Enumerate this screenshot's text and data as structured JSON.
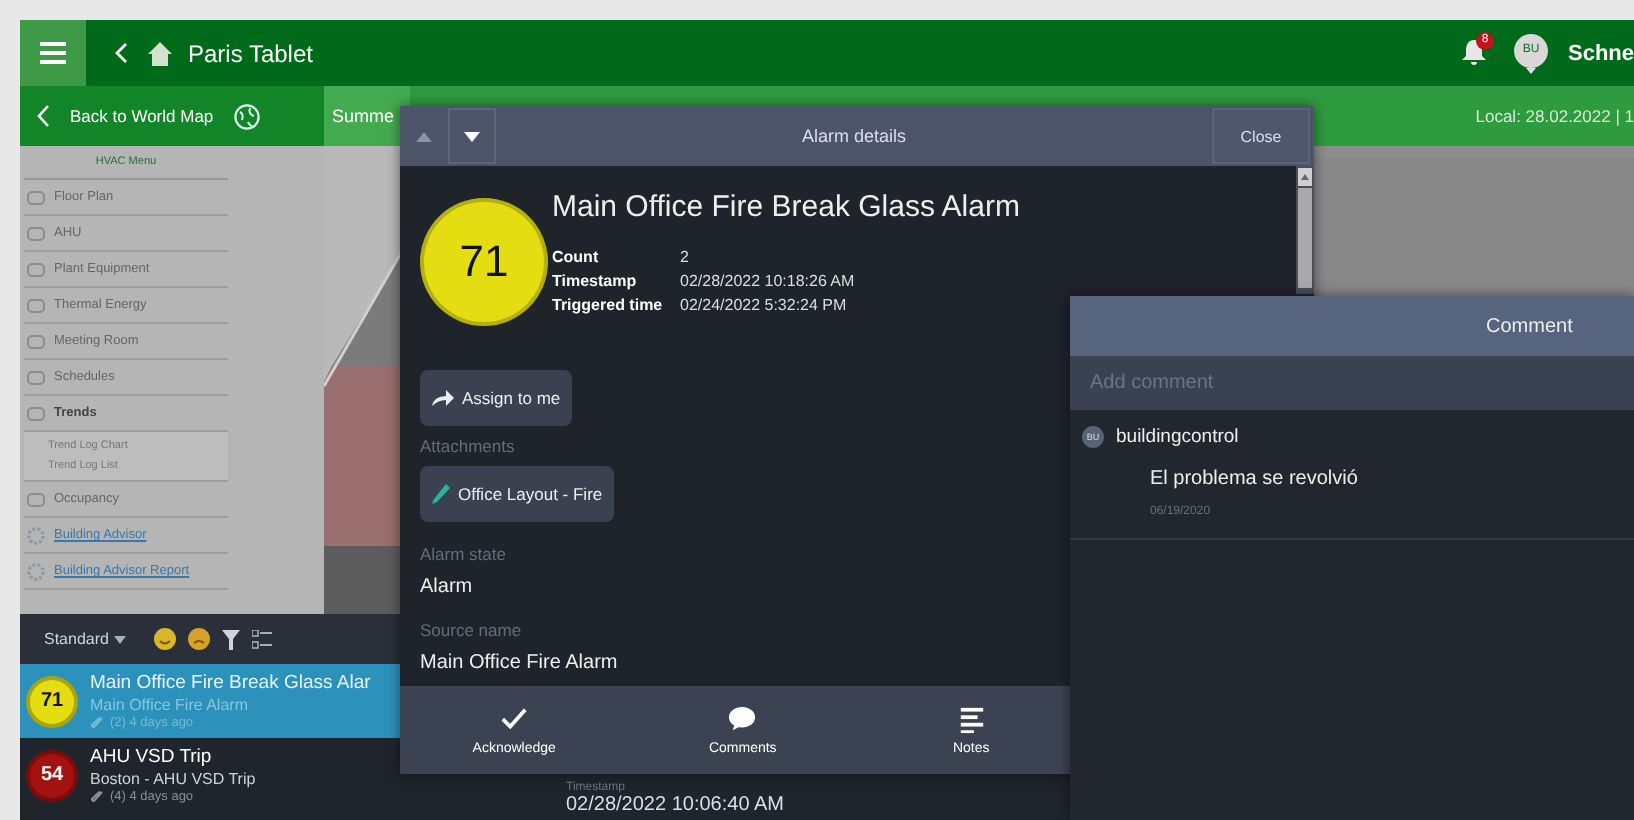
{
  "top_bar": {
    "title": "Paris Tablet",
    "notification_count": "8",
    "user_initials": "BU",
    "logo_text": "Schne"
  },
  "sub_bar": {
    "back_label": "Back to World Map",
    "tab": "Summe",
    "local_time": "Local: 28.02.2022 | 1"
  },
  "sidebar": {
    "title": "HVAC Menu",
    "items": [
      {
        "label": "Floor Plan",
        "kind": "item"
      },
      {
        "label": "AHU",
        "kind": "item"
      },
      {
        "label": "Plant Equipment",
        "kind": "item"
      },
      {
        "label": "Thermal Energy",
        "kind": "item"
      },
      {
        "label": "Meeting Room",
        "kind": "item"
      },
      {
        "label": "Schedules",
        "kind": "item"
      },
      {
        "label": "Trends",
        "kind": "item",
        "children": [
          {
            "label": "Trend Log Chart"
          },
          {
            "label": "Trend Log List"
          }
        ]
      },
      {
        "label": "Occupancy",
        "kind": "item"
      },
      {
        "label": "Building Advisor",
        "kind": "link"
      },
      {
        "label": "Building Advisor Report",
        "kind": "link"
      }
    ]
  },
  "alarm_list": {
    "view": "Standard",
    "rows": [
      {
        "priority": "71",
        "color": "#e3dd12",
        "title": "Main Office Fire Break Glass Alar",
        "source": "Main Office Fire Alarm",
        "meta": "(2) 4 days ago",
        "selected": true
      },
      {
        "priority": "54",
        "color": "#a3120f",
        "title": "AHU VSD Trip",
        "source": "Boston - AHU VSD Trip",
        "meta": "(4) 4 days ago",
        "selected": false
      }
    ],
    "detail": {
      "label": "Timestamp",
      "value": "02/28/2022 10:06:40 AM"
    }
  },
  "alarm_details": {
    "title": "Alarm details",
    "close": "Close",
    "alarm": {
      "priority": "71",
      "color": "#e3dd12",
      "name": "Main Office Fire Break Glass Alarm",
      "fields": [
        {
          "label": "Count",
          "value": "2"
        },
        {
          "label": "Timestamp",
          "value": "02/28/2022 10:18:26 AM"
        },
        {
          "label": "Triggered time",
          "value": "02/24/2022 5:32:24 PM"
        }
      ]
    },
    "assign": "Assign to me",
    "attachments_label": "Attachments",
    "attachment": "Office Layout - Fire",
    "sections": [
      {
        "label": "Alarm state",
        "value": "Alarm"
      },
      {
        "label": "Source name",
        "value": "Main Office Fire Alarm"
      }
    ],
    "actions": [
      {
        "label": "Acknowledge",
        "kind": "check"
      },
      {
        "label": "Comments",
        "kind": "comment"
      },
      {
        "label": "Notes",
        "kind": "notes"
      }
    ]
  },
  "comment_panel": {
    "title": "Comment",
    "placeholder": "Add comment",
    "comments": [
      {
        "initials": "BU",
        "author": "buildingcontrol",
        "text": "El problema se revolvió",
        "date": "06/19/2020"
      }
    ]
  }
}
